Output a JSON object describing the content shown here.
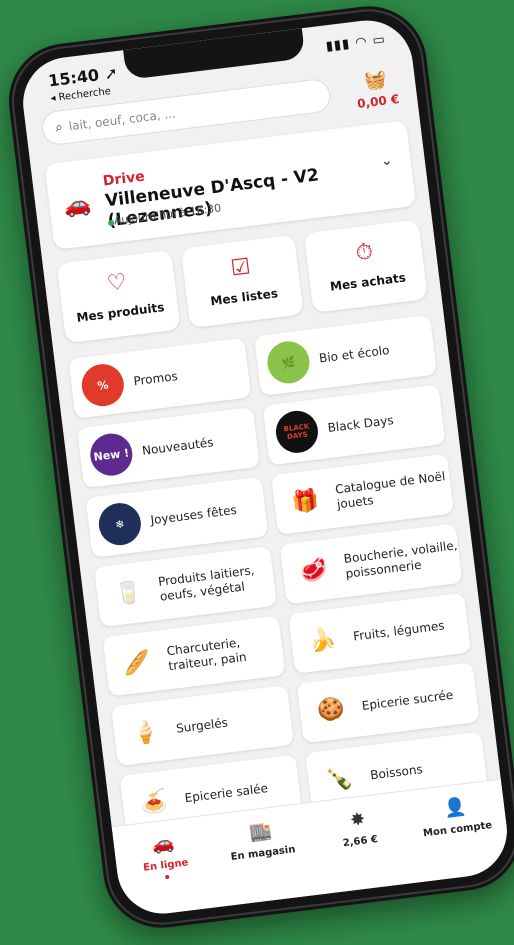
{
  "status": {
    "time": "15:40 ➚",
    "back": "◂ Recherche",
    "sys": "▮▮▮ ◠ ▭"
  },
  "search": {
    "placeholder": "lait, oeuf, coca, ...",
    "icon": "search-icon"
  },
  "cart": {
    "amount": "0,00 €",
    "icon": "basket-icon"
  },
  "drive": {
    "label": "Drive",
    "store": "Villeneuve D'Ascq - V2 (Lezennes)",
    "slot": "Aujourd'hui à 16:30",
    "color": "#d2232a"
  },
  "quick": [
    {
      "label": "Mes produits",
      "icon": "heart-list-icon"
    },
    {
      "label": "Mes listes",
      "icon": "checklist-icon"
    },
    {
      "label": "Mes achats",
      "icon": "stopwatch-icon"
    }
  ],
  "categories": [
    {
      "label": "Promos",
      "badge": "%"
    },
    {
      "label": "Bio et écolo",
      "badge": ""
    },
    {
      "label": "Nouveautés",
      "badge": "New !"
    },
    {
      "label": "Black Days",
      "badge": "BLACK DAYS"
    },
    {
      "label": "Joyeuses fêtes",
      "badge": ""
    },
    {
      "label": "Catalogue de Noël jouets",
      "badge": ""
    },
    {
      "label": "Produits laitiers, oeufs, végétal",
      "badge": ""
    },
    {
      "label": "Boucherie, volaille, poissonnerie",
      "badge": ""
    },
    {
      "label": "Charcuterie, traiteur, pain",
      "badge": ""
    },
    {
      "label": "Fruits, légumes",
      "badge": ""
    },
    {
      "label": "Surgelés",
      "badge": ""
    },
    {
      "label": "Epicerie sucrée",
      "badge": ""
    },
    {
      "label": "Epicerie salée",
      "badge": ""
    },
    {
      "label": "Boissons",
      "badge": ""
    }
  ],
  "tabs": [
    {
      "label": "En ligne",
      "icon": "car-icon",
      "active": true
    },
    {
      "label": "En magasin",
      "icon": "store-icon",
      "active": false
    },
    {
      "label": "2,66 €",
      "icon": "waaoh-icon",
      "active": false
    },
    {
      "label": "Mon compte",
      "icon": "account-icon",
      "active": false
    }
  ]
}
